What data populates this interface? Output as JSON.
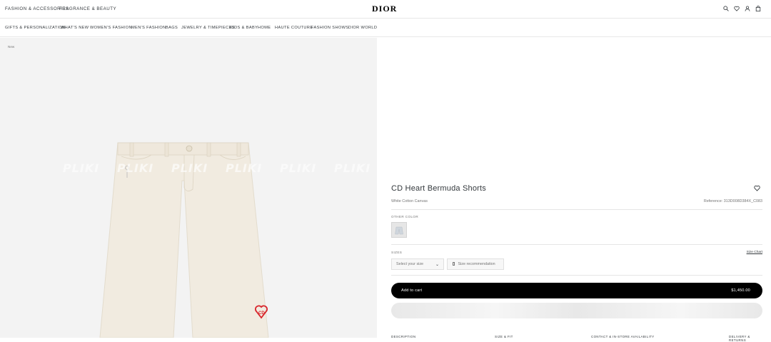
{
  "topbar": {
    "fashion_accessories": "Fashion & Accessories",
    "fragrance_beauty": "Fragrance & Beauty",
    "logo": "DIOR",
    "icons": [
      "search-icon",
      "heart-icon",
      "account-icon",
      "bag-icon"
    ]
  },
  "nav": {
    "items": [
      "Gifts & Personalization",
      "What's New",
      "Women's Fashion",
      "Men's Fashion",
      "Bags",
      "Jewelry & Timepieces",
      "Kids & Baby",
      "Home",
      "Haute Couture",
      "Fashion Shows",
      "Dior World"
    ]
  },
  "product": {
    "badge": "New",
    "watermark": "PLIKI",
    "title": "CD Heart Bermuda Shorts",
    "subtitle": "White Cotton Canvas",
    "reference": "Reference: 313D008D384X_C083",
    "other_color_label": "Other color",
    "sizes_label": "Sizes",
    "size_chart": "Size Chart",
    "select_size": "Select your size",
    "size_recommendation": "Size recommendation",
    "add_to_cart": "Add to cart",
    "price": "$1,450.00",
    "tabs": [
      "Description",
      "Size & Fit",
      "Contact & In-Store Availability",
      "Delivery & Returns"
    ]
  },
  "colors": {
    "text": "#33383c",
    "image_bg": "#f3f3f3",
    "shorts": "#f1ebe0",
    "heart": "#d8232a",
    "button": "#000000"
  }
}
